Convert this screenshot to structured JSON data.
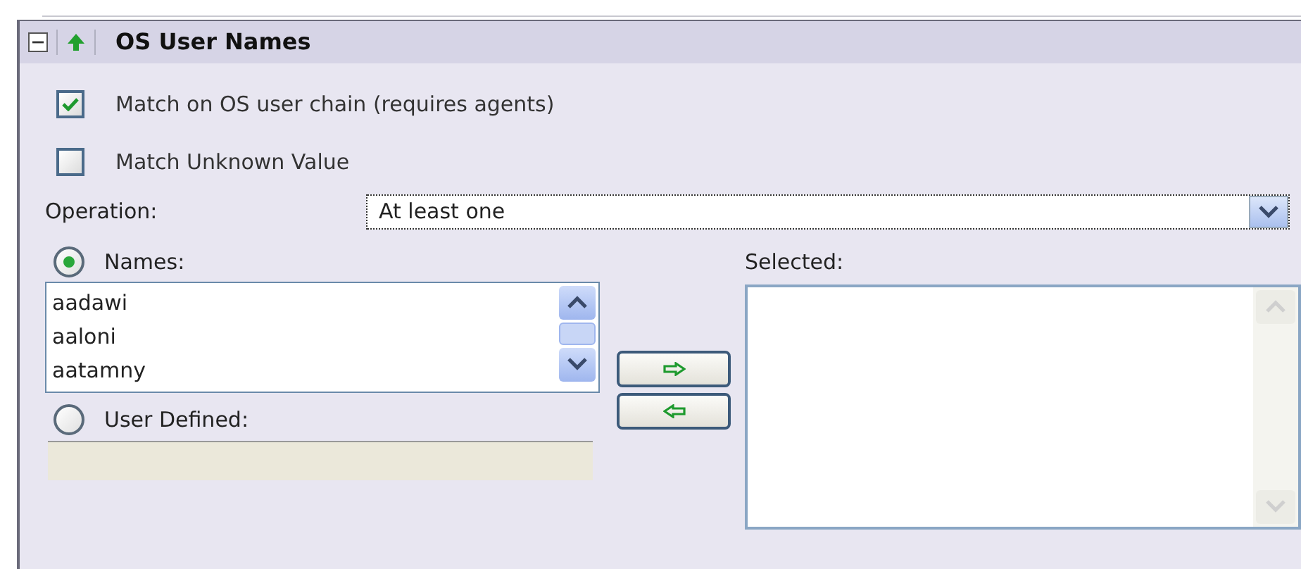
{
  "panel": {
    "title": "OS User Names",
    "expanded": true
  },
  "options": [
    {
      "label": "Match on OS user chain (requires agents)",
      "checked": true
    },
    {
      "label": "Match Unknown Value",
      "checked": false
    }
  ],
  "operation": {
    "label": "Operation:",
    "value": "At least one"
  },
  "sources": [
    {
      "label": "Names:",
      "selected": true
    },
    {
      "label": "User Defined:",
      "selected": false
    }
  ],
  "names": [
    "aadawi",
    "aaloni",
    "aatamny"
  ],
  "user_defined": {
    "disabled": true
  },
  "selected_list": {
    "label": "Selected:"
  }
}
